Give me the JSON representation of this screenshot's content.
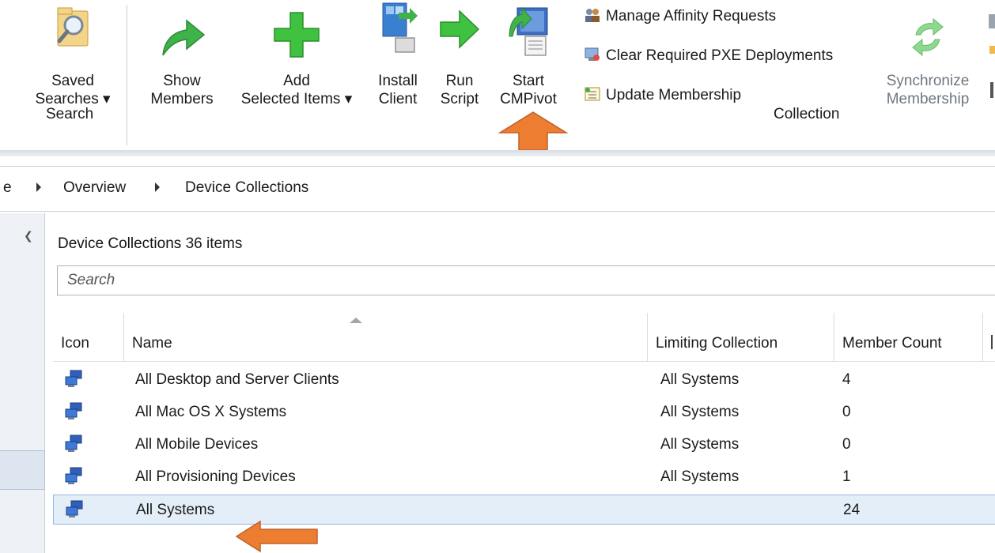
{
  "ribbon": {
    "buttons": {
      "saved_searches": [
        "Saved",
        "Searches ▾"
      ],
      "show_members": [
        "Show",
        "Members"
      ],
      "add_selected_items": [
        "Add",
        "Selected Items ▾"
      ],
      "install_client": [
        "Install",
        "Client"
      ],
      "run_script": [
        "Run",
        "Script"
      ],
      "start_cmpivot": [
        "Start",
        "CMPivot"
      ],
      "synchronize_membership": [
        "Synchronize",
        "Membership"
      ]
    },
    "small_buttons": {
      "manage_affinity": "Manage Affinity Requests",
      "clear_pxe": "Clear Required PXE Deployments",
      "update_membership": "Update Membership"
    },
    "groups": {
      "search": "Search",
      "collection": "Collection"
    }
  },
  "breadcrumb": {
    "partial_root": "e",
    "items": [
      "Overview",
      "Device Collections"
    ]
  },
  "content": {
    "title_bold": "Device Collections",
    "title_count": "36 items",
    "search_placeholder": "Search"
  },
  "grid": {
    "columns": [
      "Icon",
      "Name",
      "Limiting Collection",
      "Member Count"
    ],
    "rows": [
      {
        "name": "All Desktop and Server Clients",
        "limiting": "All Systems",
        "count": "4"
      },
      {
        "name": "All Mac OS X Systems",
        "limiting": "All Systems",
        "count": "0"
      },
      {
        "name": "All Mobile Devices",
        "limiting": "All Systems",
        "count": "0"
      },
      {
        "name": "All Provisioning Devices",
        "limiting": "All Systems",
        "count": "1"
      },
      {
        "name": "All Systems",
        "limiting": "",
        "count": "24"
      }
    ],
    "selected_row": "All Systems"
  },
  "annotations": {
    "arrow_color": "#ED7D31"
  },
  "icons": {
    "saved_searches": "magnifier-folder-icon",
    "show_members": "green-arrow-icon",
    "add_selected_items": "green-plus-icon",
    "install_client": "install-client-icon",
    "run_script": "green-arrow-right-icon",
    "start_cmpivot": "cmpivot-icon",
    "synchronize_membership": "sync-icon",
    "collection_row": "device-collection-icon"
  }
}
